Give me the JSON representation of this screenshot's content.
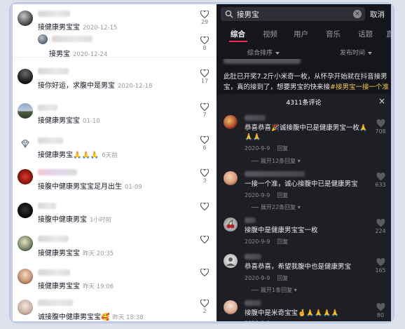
{
  "left_comments": [
    {
      "text": "接健康男宝宝",
      "date": "2020-12-15",
      "likes": "29"
    },
    {
      "text": "接男宝",
      "date": "2020-12-24",
      "likes": "8"
    },
    {
      "text": "接你好运，求腹中是男宝",
      "date": "2020-12-18",
      "likes": "17"
    },
    {
      "text": "接健康男宝宝",
      "date": "01-10",
      "likes": "7"
    },
    {
      "text": "接健康男宝🙏🙏🙏",
      "date": "6天前",
      "likes": "6"
    },
    {
      "text": "接腹中健康男宝宝足月出生",
      "date": "01-09",
      "likes": "3"
    },
    {
      "text": "接腹中健康男宝",
      "date": "1小时前",
      "likes": ""
    },
    {
      "text": "接健康男宝宝",
      "date": "昨天 20:35",
      "likes": ""
    },
    {
      "text": "接健康男宝宝",
      "date": "昨天 19:06",
      "likes": ""
    },
    {
      "text": "诚接腹中健康男宝宝🥰",
      "date": "昨天 18:38",
      "likes": "2"
    }
  ],
  "search": {
    "query": "接男宝",
    "cancel": "取消"
  },
  "tabs": [
    "综合",
    "视频",
    "用户",
    "音乐",
    "话题",
    "直"
  ],
  "filters": {
    "sort": "综合排序",
    "time": "发布时间"
  },
  "video_desc": {
    "line1": "此肚已开奖7.2斤小米奇一枚，从怀孕开始就在抖音接男",
    "line2_prefix": "宝，真的接到了，想要男宝的快来接",
    "line2_hashtag": "#接男宝一接一个准"
  },
  "sheet": {
    "title": "4311条评论",
    "close": "×",
    "reply_label": "回复"
  },
  "right_comments": [
    {
      "text1": "恭喜恭喜🎉诚接腹中已是健康男宝一枚🙏",
      "text2": "🙏🙏",
      "date": "2020-9-9",
      "likes": "708",
      "expand": "展开12条回复"
    },
    {
      "text1": "一接一个准，诚心接腹中已是健康男宝",
      "text2": "",
      "date": "2020-9-9",
      "likes": "633",
      "expand": "展开22条回复"
    },
    {
      "text1": "接腹中是健康男宝宝一枚",
      "text2": "",
      "date": "2020-9-9",
      "likes": "224",
      "expand": ""
    },
    {
      "text1": "恭喜恭喜，希望我腹中也是健康男宝",
      "text2": "",
      "date": "2020-9-9",
      "likes": "165",
      "expand": "展开1条回复"
    },
    {
      "text1": "接腹中是米奇宝宝🤞🙏🙏🙏🙏",
      "text2": "",
      "date": "2020-9-9",
      "likes": "80",
      "expand": ""
    }
  ],
  "colors": {
    "accent": "#fe2c55",
    "hashtag": "#f3c94a",
    "dark_bg": "#15161c"
  }
}
